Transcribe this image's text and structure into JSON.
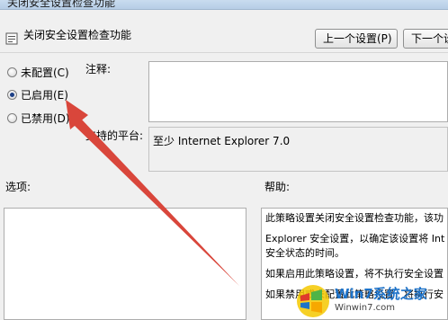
{
  "window": {
    "title": "关闭安全设置检查功能"
  },
  "header": {
    "title": "关闭安全设置检查功能"
  },
  "nav": {
    "prev_label": "上一个设置(P)",
    "next_label": "下一个设"
  },
  "state": {
    "options": [
      {
        "label": "未配置(C)",
        "selected": false
      },
      {
        "label": "已启用(E)",
        "selected": true
      },
      {
        "label": "已禁用(D)",
        "selected": false
      }
    ]
  },
  "comment": {
    "label": "注释:",
    "value": ""
  },
  "platform": {
    "label": "支持的平台:",
    "value": "至少 Internet Explorer 7.0"
  },
  "options_section": {
    "label": "选项:"
  },
  "help_section": {
    "label": "帮助:",
    "lines": [
      "此策略设置关闭安全设置检查功能，该功",
      "Explorer 安全设置，以确定该设置将 Int",
      "安全状态的时间。",
      "如果启用此策略设置，将不执行安全设置",
      "如果禁用或未配置此策略设置，将执行安"
    ]
  },
  "watermark": {
    "text": "Win7系统之家",
    "url": "Winwin7.com"
  },
  "colors": {
    "arrow": "#d9463b",
    "accent": "#1e73c9"
  }
}
